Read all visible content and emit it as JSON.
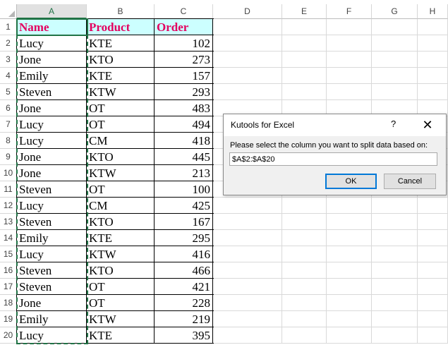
{
  "column_headers": [
    "A",
    "B",
    "C",
    "D",
    "E",
    "F",
    "G",
    "H"
  ],
  "row_headers": [
    "1",
    "2",
    "3",
    "4",
    "5",
    "6",
    "7",
    "8",
    "9",
    "10",
    "11",
    "12",
    "13",
    "14",
    "15",
    "16",
    "17",
    "18",
    "19",
    "20"
  ],
  "table": {
    "headers": [
      "Name",
      "Product",
      "Order"
    ],
    "rows": [
      [
        "Lucy",
        "KTE",
        "102"
      ],
      [
        "Jone",
        "KTO",
        "273"
      ],
      [
        "Emily",
        "KTE",
        "157"
      ],
      [
        "Steven",
        "KTW",
        "293"
      ],
      [
        "Jone",
        "OT",
        "483"
      ],
      [
        "Lucy",
        "OT",
        "494"
      ],
      [
        "Lucy",
        "CM",
        "418"
      ],
      [
        "Jone",
        "KTO",
        "445"
      ],
      [
        "Jone",
        "KTW",
        "213"
      ],
      [
        "Steven",
        "OT",
        "100"
      ],
      [
        "Lucy",
        "CM",
        "425"
      ],
      [
        "Steven",
        "KTO",
        "167"
      ],
      [
        "Emily",
        "KTE",
        "295"
      ],
      [
        "Lucy",
        "KTW",
        "416"
      ],
      [
        "Steven",
        "KTO",
        "466"
      ],
      [
        "Steven",
        "OT",
        "421"
      ],
      [
        "Jone",
        "OT",
        "228"
      ],
      [
        "Emily",
        "KTW",
        "219"
      ],
      [
        "Lucy",
        "KTE",
        "395"
      ]
    ]
  },
  "dialog": {
    "title": "Kutools for Excel",
    "help_label": "?",
    "close_label": "✕",
    "prompt": "Please select the column you want to split data based on:",
    "range_value": "$A$2:$A$20",
    "ok_label": "OK",
    "cancel_label": "Cancel"
  },
  "colors": {
    "header_fill": "#ccffff",
    "header_text": "#e3005f",
    "selection_accent": "#217346"
  }
}
